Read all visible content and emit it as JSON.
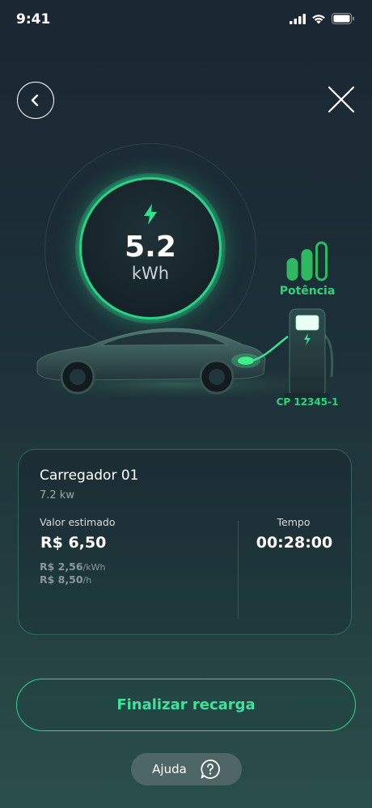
{
  "status_bar": {
    "time": "9:41"
  },
  "gauge": {
    "value": "5.2",
    "unit": "kWh"
  },
  "power": {
    "label": "Potência",
    "level_fraction": 1.0
  },
  "charger_point": {
    "id": "CP 12345-1"
  },
  "card": {
    "title": "Carregador 01",
    "subtitle": "7.2 kw",
    "estimated_label": "Valor estimado",
    "estimated_value": "R$ 6,50",
    "rate_per_kwh": "R$ 2,56",
    "rate_per_kwh_unit": "/kWh",
    "rate_per_hour": "R$ 8,50",
    "rate_per_hour_unit": "/h",
    "time_label": "Tempo",
    "time_value": "00:28:00"
  },
  "actions": {
    "finish_label": "Finalizar recarga",
    "help_label": "Ajuda"
  },
  "icons": {
    "back": "chevron-left-icon",
    "close": "close-icon",
    "bolt": "lightning-bolt-icon",
    "help": "question-bubble-icon"
  },
  "colors": {
    "accent": "#2fd47a",
    "background": "#1b2733"
  }
}
